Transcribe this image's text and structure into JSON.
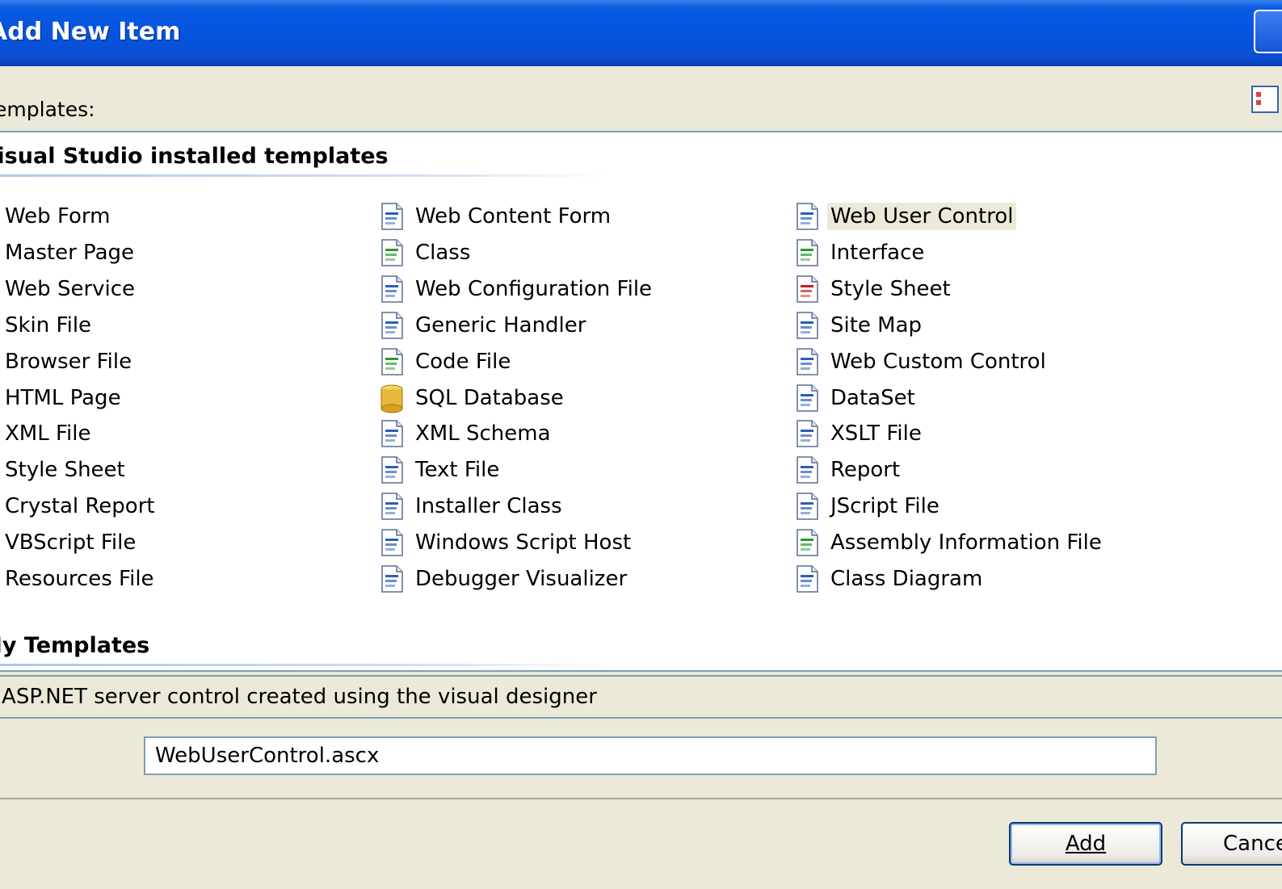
{
  "window": {
    "title": "Add New Item"
  },
  "templates_label": "Templates:",
  "groups": {
    "installed_header": "Visual Studio installed templates",
    "my_header": "My Templates"
  },
  "columns": [
    [
      {
        "label": "Web Form",
        "icon": "web-form-icon"
      },
      {
        "label": "Master Page",
        "icon": "master-page-icon"
      },
      {
        "label": "Web Service",
        "icon": "web-service-icon"
      },
      {
        "label": "Skin File",
        "icon": "skin-file-icon"
      },
      {
        "label": "Browser File",
        "icon": "browser-file-icon"
      },
      {
        "label": "HTML Page",
        "icon": "html-page-icon"
      },
      {
        "label": "XML File",
        "icon": "xml-file-icon"
      },
      {
        "label": "Style Sheet",
        "icon": "style-sheet-icon"
      },
      {
        "label": "Crystal Report",
        "icon": "crystal-report-icon"
      },
      {
        "label": "VBScript File",
        "icon": "vbscript-file-icon"
      },
      {
        "label": "Resources File",
        "icon": "resources-file-icon"
      }
    ],
    [
      {
        "label": "Web Content Form",
        "icon": "web-content-form-icon"
      },
      {
        "label": "Class",
        "icon": "csharp-class-icon"
      },
      {
        "label": "Web Configuration File",
        "icon": "web-config-icon"
      },
      {
        "label": "Generic Handler",
        "icon": "generic-handler-icon"
      },
      {
        "label": "Code File",
        "icon": "csharp-code-file-icon"
      },
      {
        "label": "SQL Database",
        "icon": "database-cylinder-icon"
      },
      {
        "label": "XML Schema",
        "icon": "xml-schema-icon"
      },
      {
        "label": "Text File",
        "icon": "text-file-icon"
      },
      {
        "label": "Installer Class",
        "icon": "installer-class-icon"
      },
      {
        "label": "Windows Script Host",
        "icon": "script-host-icon"
      },
      {
        "label": "Debugger Visualizer",
        "icon": "debugger-visualizer-icon"
      }
    ],
    [
      {
        "label": "Web User Control",
        "icon": "web-user-control-icon",
        "selected": true
      },
      {
        "label": "Interface",
        "icon": "interface-icon"
      },
      {
        "label": "Style Sheet",
        "icon": "style-sheet-a-icon"
      },
      {
        "label": "Site Map",
        "icon": "site-map-icon"
      },
      {
        "label": "Web Custom Control",
        "icon": "web-custom-control-icon"
      },
      {
        "label": "DataSet",
        "icon": "dataset-icon"
      },
      {
        "label": "XSLT File",
        "icon": "xslt-file-icon"
      },
      {
        "label": "Report",
        "icon": "report-icon"
      },
      {
        "label": "JScript File",
        "icon": "jscript-file-icon"
      },
      {
        "label": "Assembly Information File",
        "icon": "assembly-info-icon"
      },
      {
        "label": "Class Diagram",
        "icon": "class-diagram-icon"
      }
    ]
  ],
  "description": "A ASP.NET server control created using the visual designer",
  "name_field": {
    "value": "WebUserControl.ascx"
  },
  "buttons": {
    "add": "Add",
    "cancel": "Cancel"
  }
}
